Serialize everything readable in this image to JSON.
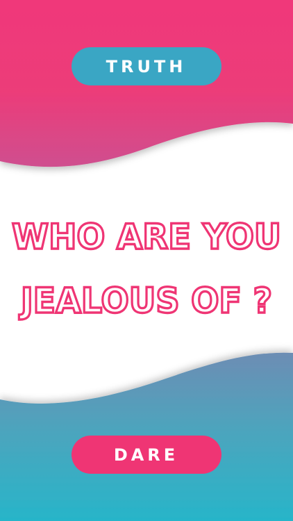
{
  "buttons": {
    "truth_label": "TRUTH",
    "dare_label": "DARE"
  },
  "question": {
    "line1": "WHO ARE YOU",
    "line2": "JEALOUS OF ?"
  },
  "colors": {
    "pink": "#ef3574",
    "teal": "#3aa6c4",
    "text_outline": "#ef3574"
  }
}
